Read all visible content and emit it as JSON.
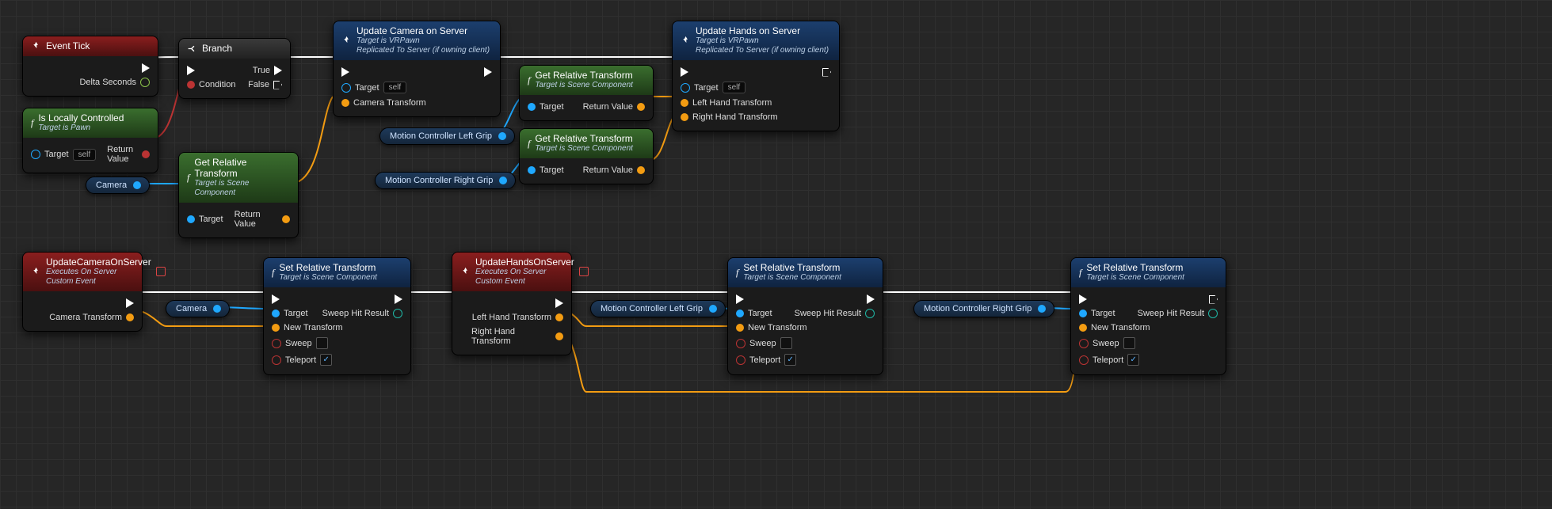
{
  "nodes": {
    "eventTick": {
      "title": "Event Tick",
      "pins": {
        "delta": "Delta Seconds"
      }
    },
    "isLocally": {
      "title": "Is Locally Controlled",
      "sub": "Target is Pawn",
      "target": "Target",
      "self": "self",
      "ret": "Return Value"
    },
    "branch": {
      "title": "Branch",
      "cond": "Condition",
      "true": "True",
      "false": "False"
    },
    "getRel1": {
      "title": "Get Relative Transform",
      "sub": "Target is Scene Component",
      "target": "Target",
      "ret": "Return Value"
    },
    "getRel2": {
      "title": "Get Relative Transform",
      "sub": "Target is Scene Component",
      "target": "Target",
      "ret": "Return Value"
    },
    "getRel3": {
      "title": "Get Relative Transform",
      "sub": "Target is Scene Component",
      "target": "Target",
      "ret": "Return Value"
    },
    "updCam": {
      "title": "Update Camera on Server",
      "sub1": "Target is VRPawn",
      "sub2": "Replicated To Server (if owning client)",
      "target": "Target",
      "self": "self",
      "camT": "Camera Transform"
    },
    "updHands": {
      "title": "Update Hands on Server",
      "sub1": "Target is VRPawn",
      "sub2": "Replicated To Server (if owning client)",
      "target": "Target",
      "self": "self",
      "lh": "Left Hand Transform",
      "rh": "Right Hand Transform"
    },
    "evtCam": {
      "title": "UpdateCameraOnServer",
      "sub1": "Executes On Server",
      "sub2": "Custom Event",
      "camT": "Camera Transform"
    },
    "evtHands": {
      "title": "UpdateHandsOnServer",
      "sub1": "Executes On Server",
      "sub2": "Custom Event",
      "lh": "Left Hand Transform",
      "rh": "Right Hand Transform"
    },
    "setRel": {
      "title": "Set Relative Transform",
      "sub": "Target is Scene Component",
      "target": "Target",
      "newT": "New Transform",
      "sweep": "Sweep",
      "teleport": "Teleport",
      "hit": "Sweep Hit Result"
    }
  },
  "vars": {
    "camera": "Camera",
    "mcLeft": "Motion Controller Left Grip",
    "mcRight": "Motion Controller Right Grip"
  }
}
